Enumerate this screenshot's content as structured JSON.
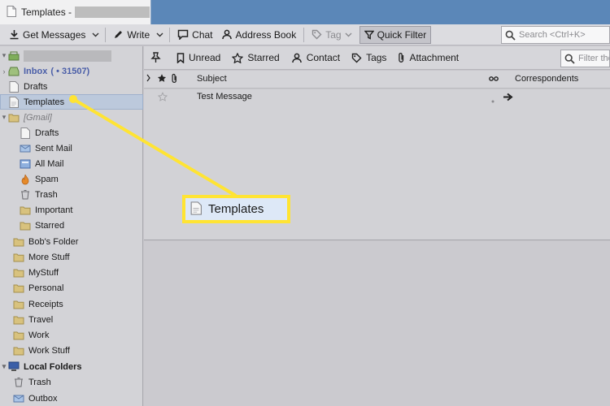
{
  "tab": {
    "title": "Templates -"
  },
  "toolbar": {
    "get_messages": "Get Messages",
    "write": "Write",
    "chat": "Chat",
    "address_book": "Address Book",
    "tag": "Tag",
    "quick_filter": "Quick Filter",
    "search_placeholder": "Search <Ctrl+K>"
  },
  "folders": {
    "inbox": "Inbox",
    "inbox_count": "( • 31507)",
    "drafts": "Drafts",
    "templates": "Templates",
    "gmail": "[Gmail]",
    "gmail_items": [
      "Drafts",
      "Sent Mail",
      "All Mail",
      "Spam",
      "Trash",
      "Important",
      "Starred"
    ],
    "user_folders": [
      "Bob's Folder",
      "More Stuff",
      "MyStuff",
      "Personal",
      "Receipts",
      "Travel",
      "Work",
      "Work Stuff"
    ],
    "local_folders": "Local Folders",
    "local_items": [
      "Trash",
      "Outbox"
    ]
  },
  "filterbar": {
    "unread": "Unread",
    "starred": "Starred",
    "contact": "Contact",
    "tags": "Tags",
    "attachment": "Attachment",
    "search_placeholder": "Filter these messages <Ctrl+Shift+K>"
  },
  "columns": {
    "subject": "Subject",
    "correspondents": "Correspondents"
  },
  "messages": [
    {
      "subject": "Test Message"
    }
  ],
  "callout": {
    "label": "Templates"
  },
  "colors": {
    "callout": "#ffe433",
    "tabbar": "#5b87b8",
    "selected": "#bcc9dc"
  }
}
